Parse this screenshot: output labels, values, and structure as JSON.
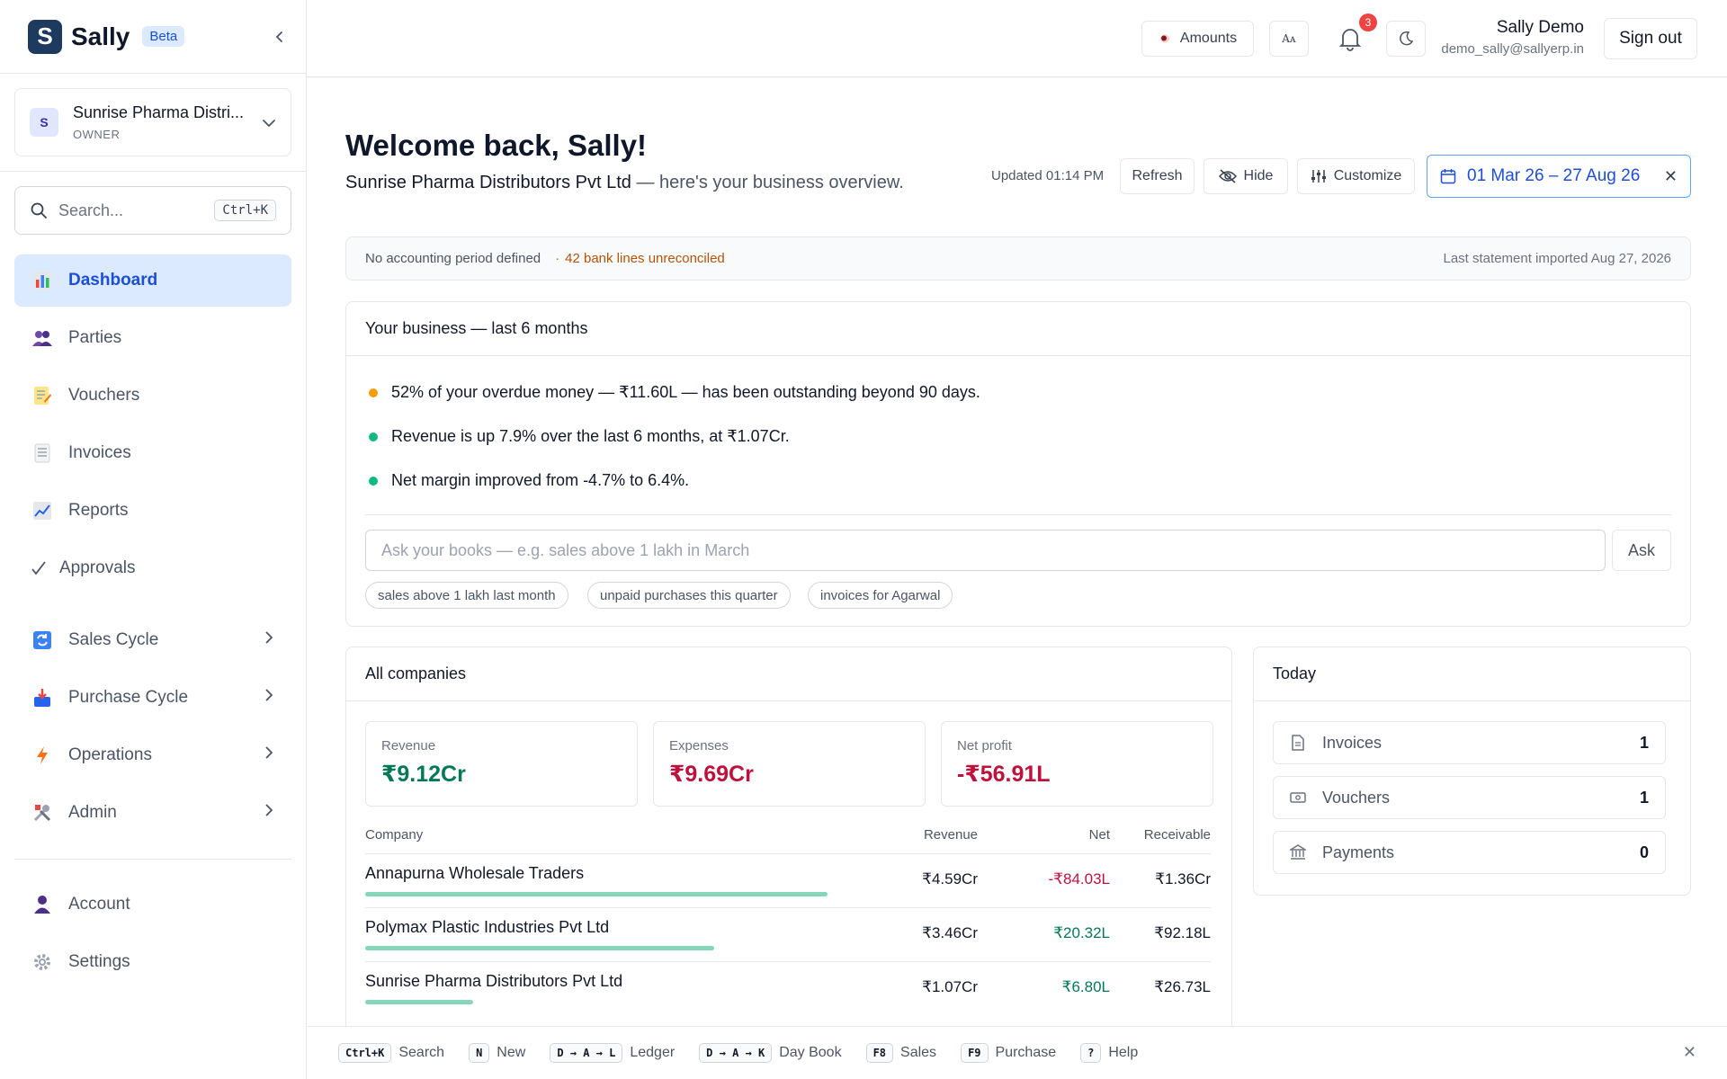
{
  "brand": {
    "initial": "S",
    "name": "Sally",
    "badge": "Beta"
  },
  "company": {
    "initial": "S",
    "name": "Sunrise Pharma Distri...",
    "role": "OWNER"
  },
  "search": {
    "placeholder": "Search...",
    "shortcut": "Ctrl+K"
  },
  "nav": [
    {
      "label": "Dashboard",
      "icon": "bar-chart-icon"
    },
    {
      "label": "Parties",
      "icon": "people-icon"
    },
    {
      "label": "Vouchers",
      "icon": "memo-icon"
    },
    {
      "label": "Invoices",
      "icon": "document-icon"
    },
    {
      "label": "Reports",
      "icon": "line-chart-icon"
    },
    {
      "label": "Approvals",
      "icon": "check-icon"
    },
    {
      "label": "Sales Cycle",
      "icon": "cycle-icon"
    },
    {
      "label": "Purchase Cycle",
      "icon": "inbox-icon"
    },
    {
      "label": "Operations",
      "icon": "bolt-icon"
    },
    {
      "label": "Admin",
      "icon": "tools-icon"
    },
    {
      "label": "Account",
      "icon": "person-icon"
    },
    {
      "label": "Settings",
      "icon": "gear-icon"
    }
  ],
  "topbar": {
    "amounts_label": "Amounts",
    "font_label": "Aᴀ",
    "notification_count": "3",
    "user_name": "Sally Demo",
    "user_email": "demo_sally@sallyerp.in",
    "signout_label": "Sign out"
  },
  "header": {
    "welcome": "Welcome back, Sally!",
    "company": "Sunrise Pharma Distributors Pvt Ltd",
    "tagline": " — here's your business overview.",
    "updated": "Updated 01:14 PM",
    "refresh_label": "Refresh",
    "hide_label": "Hide",
    "customize_label": "Customize",
    "date_range": "01 Mar 26 – 27 Aug 26"
  },
  "status": {
    "period": "No accounting period defined",
    "separator": "·",
    "unreconciled": "42 bank lines unreconciled",
    "last_statement": "Last statement imported Aug 27, 2026"
  },
  "business": {
    "title": "Your business — last 6 months",
    "insights": [
      {
        "text": "52% of your overdue money — ₹11.60L — has been outstanding beyond 90 days.",
        "color": "#f59e0b"
      },
      {
        "text": "Revenue is up 7.9% over the last 6 months, at ₹1.07Cr.",
        "color": "#10b981"
      },
      {
        "text": "Net margin improved from -4.7% to 6.4%.",
        "color": "#10b981"
      }
    ],
    "ask_placeholder": "Ask your books — e.g. sales above 1 lakh in March",
    "ask_label": "Ask",
    "chips": [
      "sales above 1 lakh last month",
      "unpaid purchases this quarter",
      "invoices for Agarwal"
    ]
  },
  "companies": {
    "title": "All companies",
    "kpis": [
      {
        "label": "Revenue",
        "value": "₹9.12Cr",
        "color": "#047857"
      },
      {
        "label": "Expenses",
        "value": "₹9.69Cr",
        "color": "#be123c"
      },
      {
        "label": "Net profit",
        "value": "-₹56.91L",
        "color": "#be123c"
      }
    ],
    "columns": {
      "company": "Company",
      "revenue": "Revenue",
      "net": "Net",
      "receivable": "Receivable"
    },
    "rows": [
      {
        "name": "Annapurna Wholesale Traders",
        "revenue": "₹4.59Cr",
        "net": "-₹84.03L",
        "net_color": "#be123c",
        "receivable": "₹1.36Cr",
        "share": 1.0
      },
      {
        "name": "Polymax Plastic Industries Pvt Ltd",
        "revenue": "₹3.46Cr",
        "net": "₹20.32L",
        "net_color": "#047857",
        "receivable": "₹92.18L",
        "share": 0.754
      },
      {
        "name": "Sunrise Pharma Distributors Pvt Ltd",
        "revenue": "₹1.07Cr",
        "net": "₹6.80L",
        "net_color": "#047857",
        "receivable": "₹26.73L",
        "share": 0.233
      }
    ]
  },
  "today": {
    "title": "Today",
    "items": [
      {
        "label": "Invoices",
        "count": "1",
        "icon": "file-icon"
      },
      {
        "label": "Vouchers",
        "count": "1",
        "icon": "banknote-icon"
      },
      {
        "label": "Payments",
        "count": "0",
        "icon": "bank-icon"
      }
    ]
  },
  "shortcuts": [
    {
      "key": "Ctrl+K",
      "label": "Search"
    },
    {
      "key": "N",
      "label": "New"
    },
    {
      "key": "D → A → L",
      "label": "Ledger"
    },
    {
      "key": "D → A → K",
      "label": "Day Book"
    },
    {
      "key": "F8",
      "label": "Sales"
    },
    {
      "key": "F9",
      "label": "Purchase"
    },
    {
      "key": "?",
      "label": "Help"
    }
  ]
}
